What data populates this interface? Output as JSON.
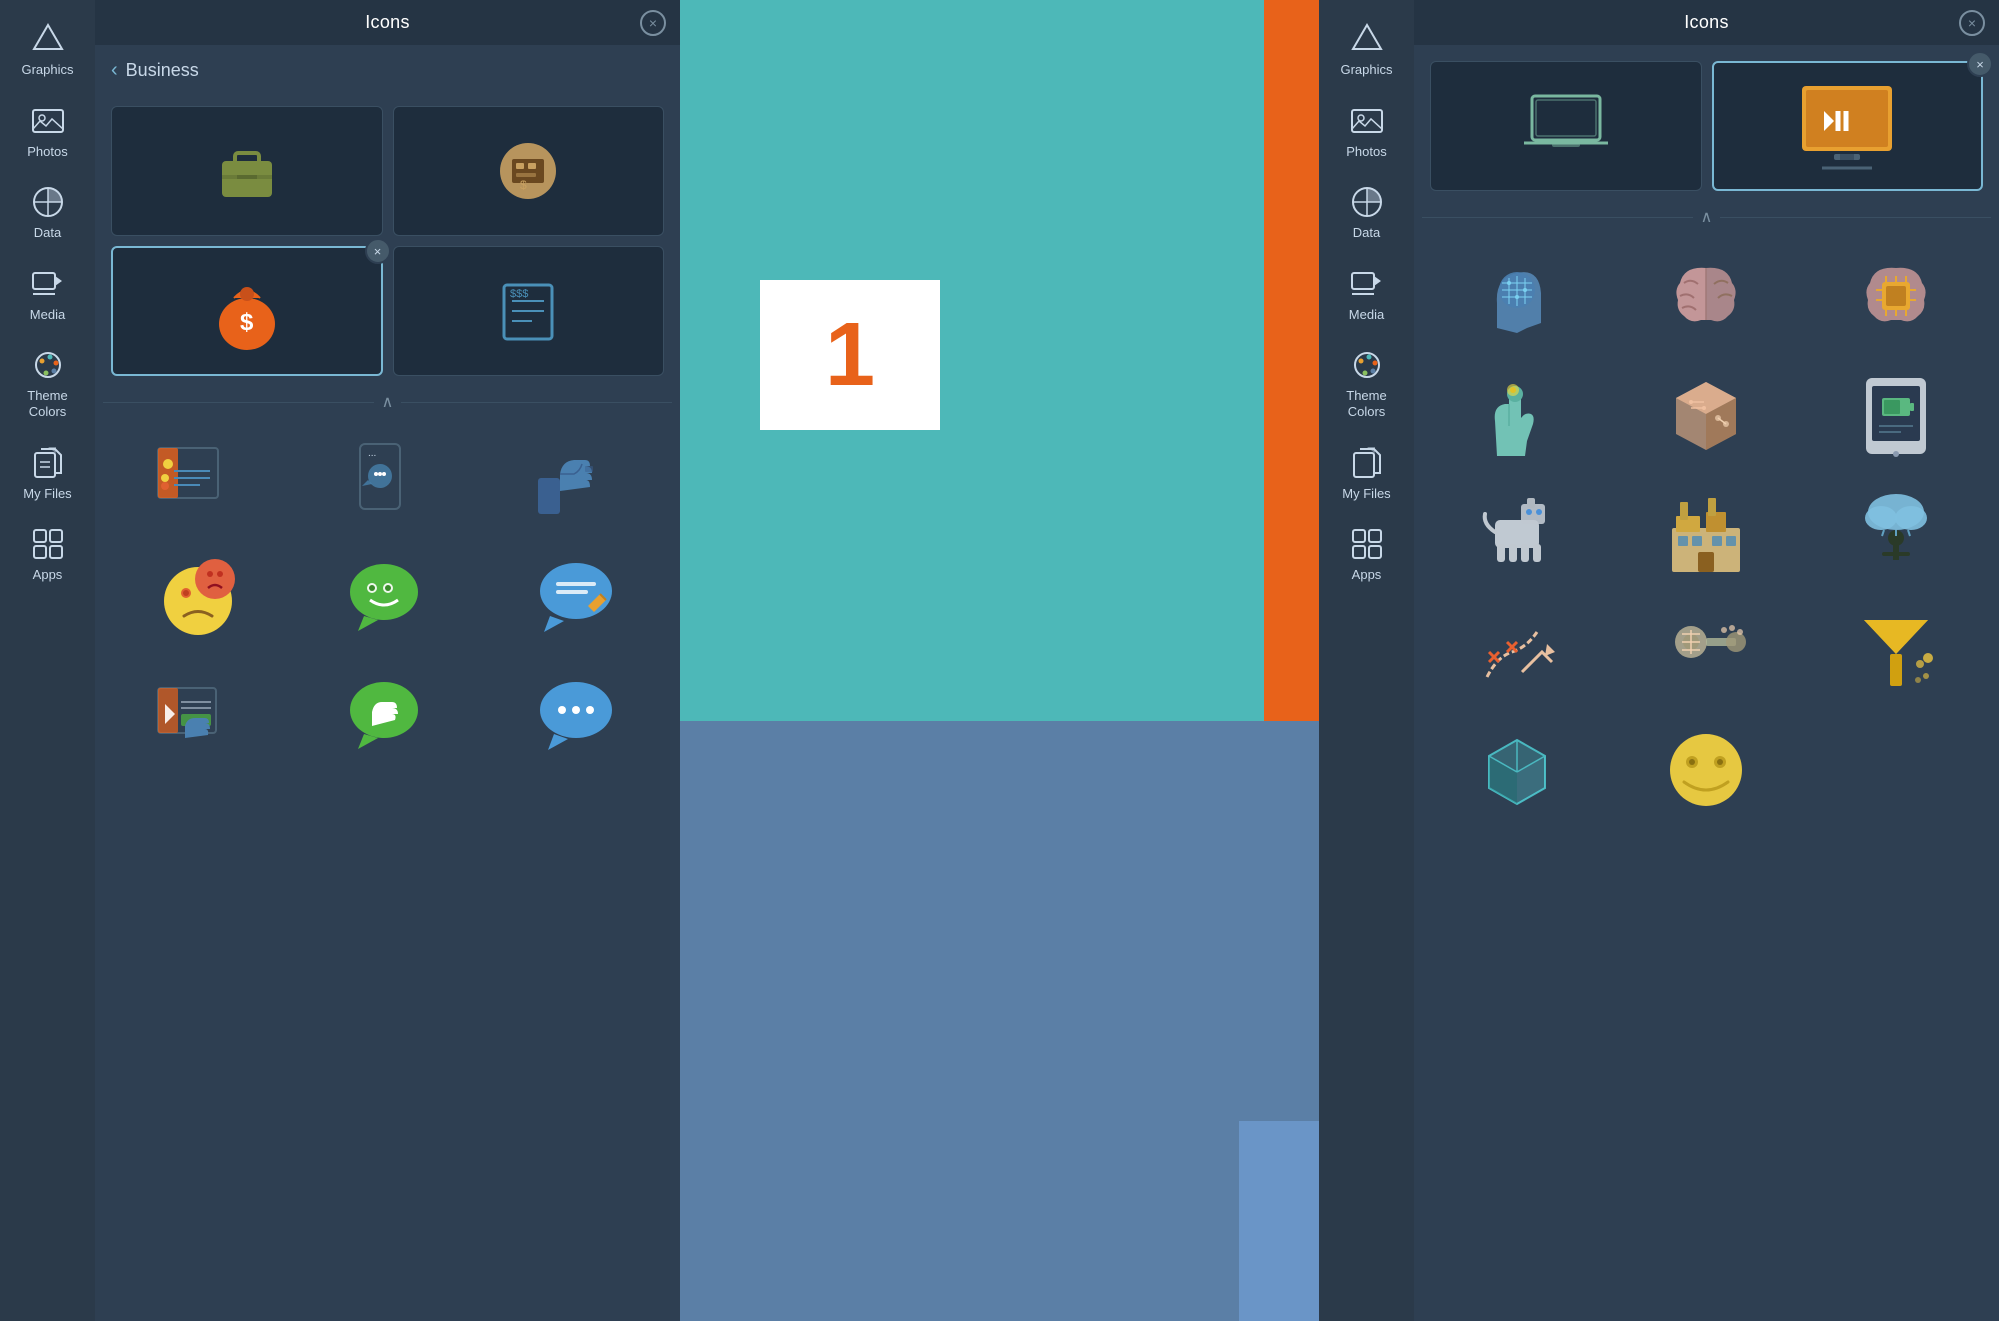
{
  "panels": [
    {
      "id": "left",
      "header": {
        "title": "Icons",
        "close_label": "×"
      },
      "back_nav": {
        "chevron": "‹",
        "label": "Business"
      },
      "sidebar": {
        "items": [
          {
            "id": "graphics",
            "label": "Graphics",
            "icon": "graphics"
          },
          {
            "id": "photos",
            "label": "Photos",
            "icon": "photos"
          },
          {
            "id": "data",
            "label": "Data",
            "icon": "data"
          },
          {
            "id": "media",
            "label": "Media",
            "icon": "media"
          },
          {
            "id": "theme-colors",
            "label": "Theme\nColors",
            "icon": "palette"
          },
          {
            "id": "my-files",
            "label": "My Files",
            "icon": "files"
          },
          {
            "id": "apps",
            "label": "Apps",
            "icon": "apps"
          }
        ]
      },
      "selected_icons": [
        {
          "id": "briefcase",
          "has_remove": false
        },
        {
          "id": "cash-register",
          "has_remove": false
        },
        {
          "id": "money-bag",
          "has_remove": true
        },
        {
          "id": "invoice",
          "has_remove": false
        }
      ],
      "scroll_icons": [
        {
          "id": "review-screen",
          "type": "emoji-tech"
        },
        {
          "id": "phone-chat",
          "type": "emoji-tech"
        },
        {
          "id": "thumbs-up-hand",
          "type": "emoji-tech"
        },
        {
          "id": "smiley-sad",
          "type": "emoji"
        },
        {
          "id": "speech-bubble-smile",
          "type": "emoji"
        },
        {
          "id": "speech-pencil",
          "type": "emoji"
        },
        {
          "id": "video-thumbs",
          "type": "emoji-tech"
        },
        {
          "id": "chat-thumbs",
          "type": "emoji"
        },
        {
          "id": "chat-dots",
          "type": "emoji"
        }
      ]
    },
    {
      "id": "right",
      "header": {
        "title": "Icons",
        "close_label": "×"
      },
      "sidebar": {
        "items": [
          {
            "id": "graphics",
            "label": "Graphics",
            "icon": "graphics"
          },
          {
            "id": "photos",
            "label": "Photos",
            "icon": "photos"
          },
          {
            "id": "data",
            "label": "Data",
            "icon": "data"
          },
          {
            "id": "media",
            "label": "Media",
            "icon": "media"
          },
          {
            "id": "theme-colors",
            "label": "Theme\nColors",
            "icon": "palette"
          },
          {
            "id": "my-files",
            "label": "My Files",
            "icon": "files"
          },
          {
            "id": "apps",
            "label": "Apps",
            "icon": "apps"
          }
        ]
      },
      "selected_icons": [
        {
          "id": "laptop-outline",
          "has_remove": false
        },
        {
          "id": "monitor-orange",
          "has_remove": true
        }
      ],
      "scroll_icons": [
        {
          "id": "ai-head",
          "type": "tech"
        },
        {
          "id": "brain-circuit",
          "type": "tech"
        },
        {
          "id": "brain-chip",
          "type": "tech"
        },
        {
          "id": "robot-hand",
          "type": "tech"
        },
        {
          "id": "circuit-cube",
          "type": "tech"
        },
        {
          "id": "robot-phone",
          "type": "tech"
        },
        {
          "id": "robot-dog",
          "type": "tech"
        },
        {
          "id": "factory-building",
          "type": "tech"
        },
        {
          "id": "cloud-tree",
          "type": "tech"
        },
        {
          "id": "path-x",
          "type": "tech"
        },
        {
          "id": "robot-parts",
          "type": "tech"
        },
        {
          "id": "funnel-gold",
          "type": "tech"
        },
        {
          "id": "cube-3d",
          "type": "tech"
        },
        {
          "id": "smiley-tech",
          "type": "tech"
        }
      ]
    }
  ],
  "divider_arrow": "∧",
  "colors": {
    "sidebar_bg": "#2b3a4a",
    "panel_bg": "#2e3f52",
    "header_bg": "#253444",
    "cell_bg": "#1e2d3d",
    "accent_teal": "#4db8b8",
    "accent_orange": "#e8621a",
    "text_light": "#c8d8e8",
    "text_dim": "#7a8fa0"
  }
}
